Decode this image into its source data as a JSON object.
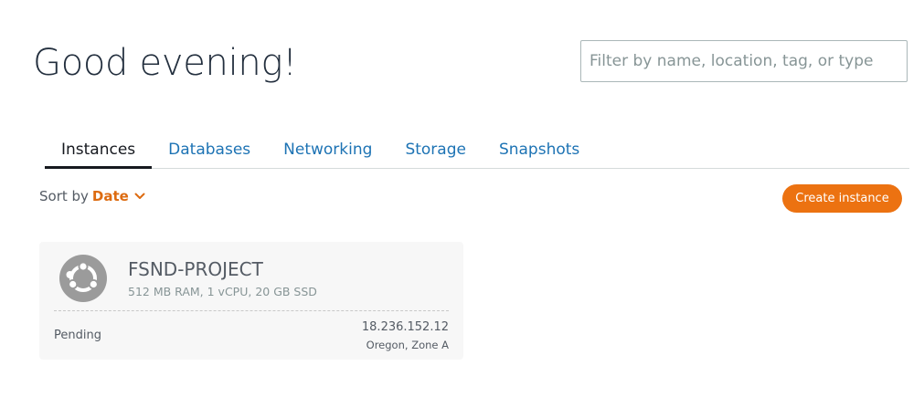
{
  "header": {
    "greeting": "Good evening!",
    "filter_placeholder": "Filter by name, location, tag, or type"
  },
  "tabs": [
    {
      "label": "Instances",
      "active": true
    },
    {
      "label": "Databases",
      "active": false
    },
    {
      "label": "Networking",
      "active": false
    },
    {
      "label": "Storage",
      "active": false
    },
    {
      "label": "Snapshots",
      "active": false
    }
  ],
  "toolbar": {
    "sort_label": "Sort by",
    "sort_value": "Date",
    "create_label": "Create instance"
  },
  "instance": {
    "icon": "ubuntu-icon",
    "name": "FSND-PROJECT",
    "spec": "512 MB RAM, 1 vCPU, 20 GB SSD",
    "status": "Pending",
    "ip": "18.236.152.12",
    "zone": "Oregon, Zone A"
  },
  "colors": {
    "link": "#1d73b4",
    "accent": "#ec7211",
    "sort_accent": "#dd6b10"
  }
}
